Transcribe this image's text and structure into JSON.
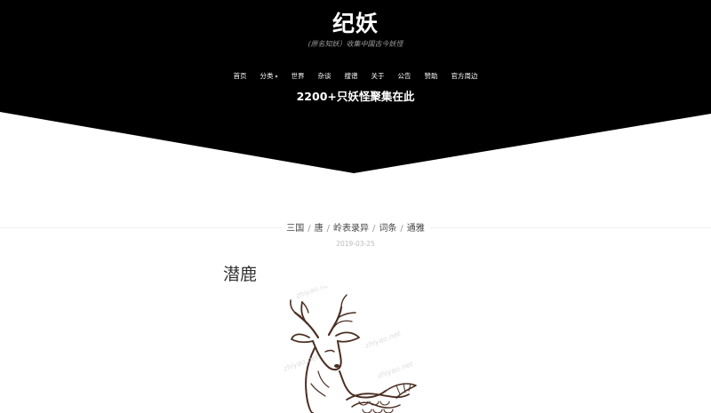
{
  "header": {
    "site_title": "纪妖",
    "subtitle": "(原名知妖）收集中国古今妖怪",
    "tagline": "2200+只妖怪聚集在此",
    "nav": [
      {
        "label": "首页"
      },
      {
        "label": "分类",
        "has_dropdown": true
      },
      {
        "label": "世界"
      },
      {
        "label": "杂谈"
      },
      {
        "label": "搜谱"
      },
      {
        "label": "关于"
      },
      {
        "label": "公告"
      },
      {
        "label": "赞助"
      },
      {
        "label": "官方周边"
      }
    ]
  },
  "post": {
    "categories": [
      "三国",
      "唐",
      "岭表录异",
      "词条",
      "通雅"
    ],
    "separator": "/",
    "date": "2019-03-25",
    "title": "潜鹿",
    "image_icon": "deer-illustration-icon",
    "watermark_text": "zhiyao.net"
  },
  "colors": {
    "header_bg": "#000000",
    "page_bg": "#ffffff",
    "ink": "#4a2e22"
  }
}
